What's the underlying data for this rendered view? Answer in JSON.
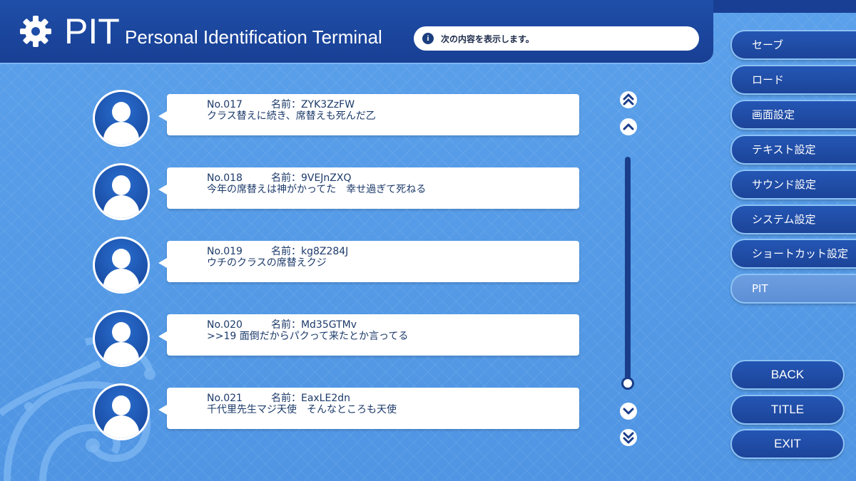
{
  "header": {
    "logo": "PIT",
    "subtitle": "Personal Identification Terminal",
    "info_icon": "i",
    "info_text": "次の内容を表示します。"
  },
  "messages": [
    {
      "no": "No.017",
      "name": "名前：ZYK3ZzFW",
      "text": "クラス替えに続き、席替えも死んだ乙"
    },
    {
      "no": "No.018",
      "name": "名前：9VEJnZXQ",
      "text": "今年の席替えは神がかってた　幸せ過ぎて死ねる"
    },
    {
      "no": "No.019",
      "name": "名前：kg8Z284J",
      "text": "ウチのクラスの席替えクジ"
    },
    {
      "no": "No.020",
      "name": "名前：Md35GTMv",
      "text": ">>19 面倒だからパクって来たとか言ってる"
    },
    {
      "no": "No.021",
      "name": "名前：EaxLE2dn",
      "text": "千代里先生マジ天使　そんなところも天使"
    }
  ],
  "menu": [
    {
      "label": "セーブ",
      "active": false
    },
    {
      "label": "ロード",
      "active": false
    },
    {
      "label": "画面設定",
      "active": false
    },
    {
      "label": "テキスト設定",
      "active": false
    },
    {
      "label": "サウンド設定",
      "active": false
    },
    {
      "label": "システム設定",
      "active": false
    },
    {
      "label": "ショートカット設定",
      "active": false
    },
    {
      "label": "PIT",
      "active": true
    }
  ],
  "nav": {
    "back": "BACK",
    "title": "TITLE",
    "exit": "EXIT"
  },
  "icons": {
    "settings": "gear-icon",
    "info": "info-icon",
    "scroll_top": "double-chevron-up-icon",
    "scroll_up": "chevron-up-icon",
    "scroll_down": "chevron-down-icon",
    "scroll_bottom": "double-chevron-down-icon",
    "avatar": "user-avatar-icon"
  },
  "scroll": {
    "position": 1.0
  },
  "colors": {
    "background": "#5a9ee8",
    "header": "#1f4ea8",
    "button": "#2456b4",
    "button_active": "#6d9ee0",
    "text_dark": "#1c3a6a"
  }
}
